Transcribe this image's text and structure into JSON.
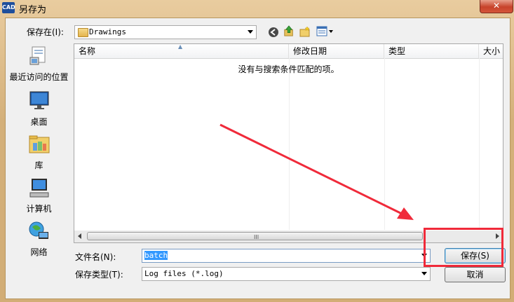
{
  "window": {
    "title": "另存为",
    "app_icon_text": "CAD",
    "close_glyph": "✕"
  },
  "save_in": {
    "label": "保存在(I):",
    "value": "Drawings"
  },
  "places": [
    {
      "label": "最近访问的位置",
      "icon": "recent-places-icon"
    },
    {
      "label": "桌面",
      "icon": "desktop-icon"
    },
    {
      "label": "库",
      "icon": "libraries-icon"
    },
    {
      "label": "计算机",
      "icon": "computer-icon"
    },
    {
      "label": "网络",
      "icon": "network-icon"
    }
  ],
  "columns": [
    "名称",
    "修改日期",
    "类型",
    "大小"
  ],
  "empty_message": "没有与搜索条件匹配的项。",
  "scroll_grip": "III",
  "filename": {
    "label": "文件名(N):",
    "value": "batch"
  },
  "filetype": {
    "label": "保存类型(T):",
    "value": "Log files (*.log)"
  },
  "buttons": {
    "save": "保存(S)",
    "cancel": "取消"
  },
  "colors": {
    "annotation": "#f02a3a",
    "selection": "#3399ff"
  }
}
